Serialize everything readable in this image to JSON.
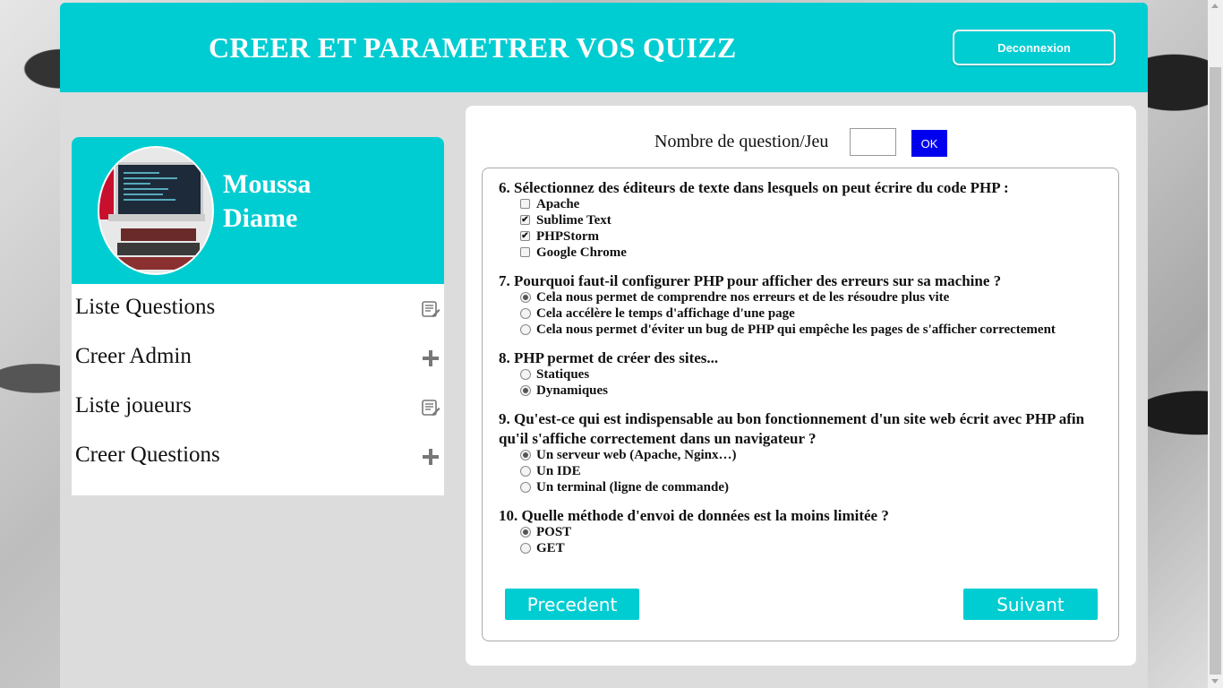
{
  "header": {
    "title": "CREER ET PARAMETRER VOS QUIZZ",
    "logout_label": "Deconnexion"
  },
  "profile": {
    "first_name": "Moussa",
    "last_name": "Diame"
  },
  "menu": [
    {
      "label": "Liste Questions",
      "icon": "list-edit-icon"
    },
    {
      "label": "Creer Admin",
      "icon": "plus-icon"
    },
    {
      "label": "Liste joueurs",
      "icon": "list-edit-icon"
    },
    {
      "label": "Creer Questions",
      "icon": "plus-icon"
    }
  ],
  "settings": {
    "label": "Nombre de question/Jeu",
    "input_value": "",
    "ok_label": "OK"
  },
  "questions": [
    {
      "text": "6. Sélectionnez des éditeurs de texte dans lesquels on peut écrire du code PHP :",
      "type": "checkbox",
      "options": [
        {
          "label": "Apache",
          "checked": false
        },
        {
          "label": "Sublime Text",
          "checked": true
        },
        {
          "label": "PHPStorm",
          "checked": true
        },
        {
          "label": "Google Chrome",
          "checked": false
        }
      ]
    },
    {
      "text": "7. Pourquoi faut-il configurer PHP pour afficher des erreurs sur sa machine ?",
      "type": "radio",
      "options": [
        {
          "label": "Cela nous permet de comprendre nos erreurs et de les résoudre plus vite",
          "checked": true
        },
        {
          "label": "Cela accélère le temps d'affichage d'une page",
          "checked": false
        },
        {
          "label": "Cela nous permet d'éviter un bug de PHP qui empêche les pages de s'afficher correctement",
          "checked": false
        }
      ]
    },
    {
      "text": "8. PHP permet de créer des sites...",
      "type": "radio",
      "options": [
        {
          "label": "Statiques",
          "checked": false
        },
        {
          "label": "Dynamiques",
          "checked": true
        }
      ]
    },
    {
      "text": "9. Qu'est-ce qui est indispensable au bon fonctionnement d'un site web écrit avec PHP afin qu'il s'affiche correctement dans un navigateur ?",
      "type": "radio",
      "options": [
        {
          "label": "Un serveur web (Apache, Nginx…)",
          "checked": true
        },
        {
          "label": "Un IDE",
          "checked": false
        },
        {
          "label": "Un terminal (ligne de commande)",
          "checked": false
        }
      ]
    },
    {
      "text": "10. Quelle méthode d'envoi de données est la moins limitée ?",
      "type": "radio",
      "options": [
        {
          "label": "POST",
          "checked": true
        },
        {
          "label": "GET",
          "checked": false
        }
      ]
    }
  ],
  "pagination": {
    "prev_label": "Precedent",
    "next_label": "Suivant"
  },
  "colors": {
    "accent": "#00cdd2",
    "ok_button": "#0000ee"
  }
}
